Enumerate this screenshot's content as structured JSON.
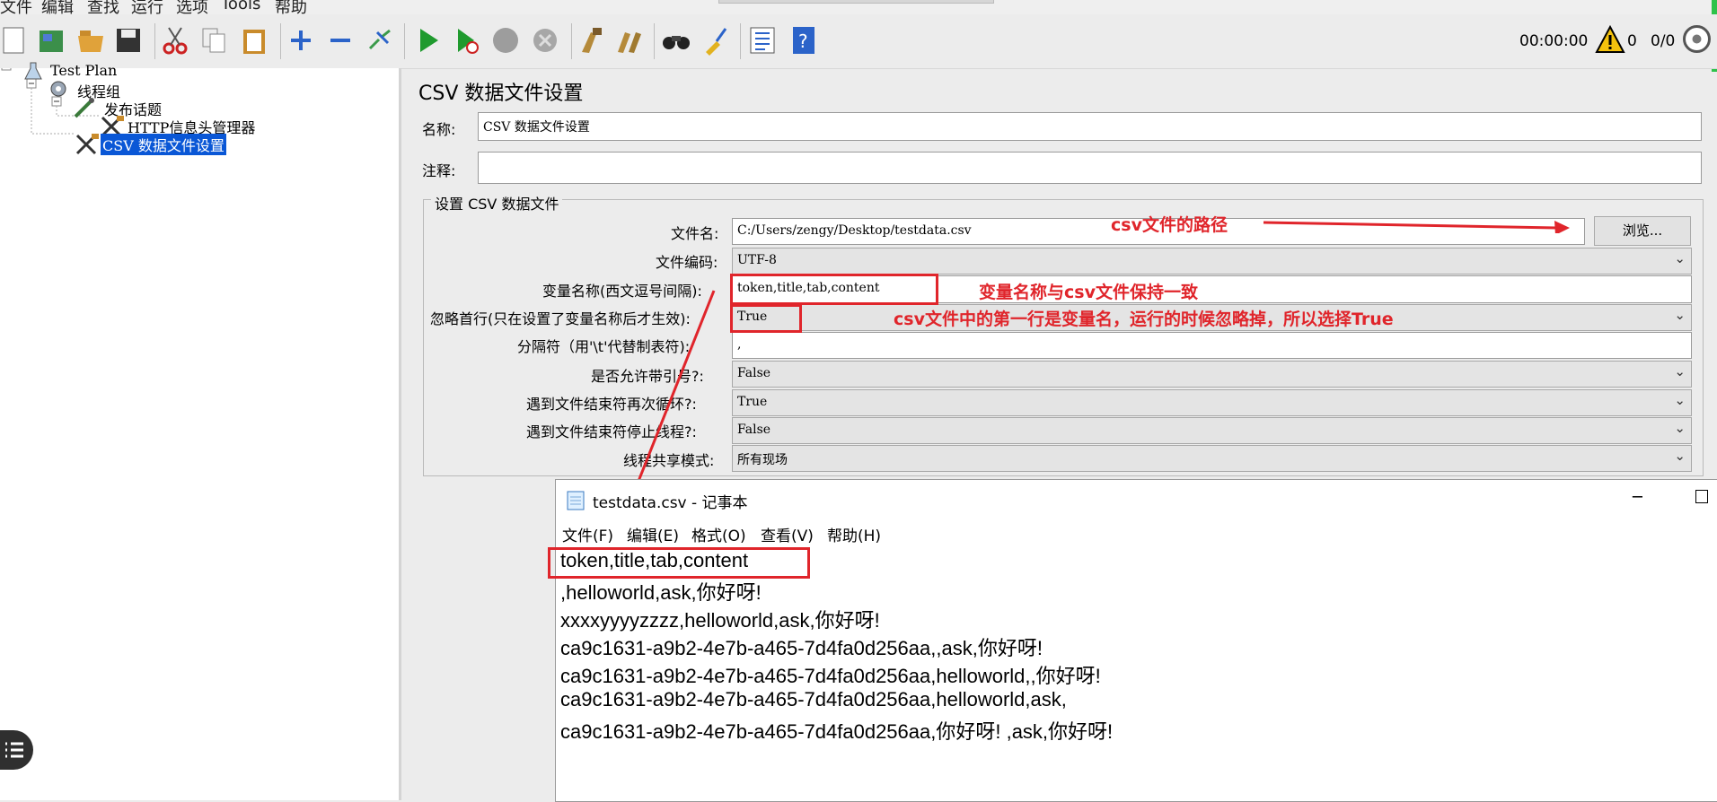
{
  "menubar": [
    "文件",
    "编辑",
    "查找",
    "运行",
    "选项",
    "Tools",
    "帮助"
  ],
  "toolbar": {
    "icons": [
      "new-icon",
      "templates-icon",
      "open-icon",
      "save-icon",
      "cut-icon",
      "copy-icon",
      "paste-icon",
      "expand-icon",
      "collapse-icon",
      "toggle-icon",
      "start-icon",
      "start-no-timers-icon",
      "stop-icon",
      "shutdown-icon",
      "clear-icon",
      "clear-all-icon",
      "search-icon",
      "reset-search-icon",
      "function-helper-icon",
      "help-icon"
    ],
    "timer": "00:00:00",
    "warnings": "0",
    "threads": "0/0"
  },
  "tree": {
    "items": [
      "Test Plan",
      "线程组",
      "发布话题",
      "HTTP信息头管理器",
      "CSV 数据文件设置"
    ]
  },
  "panel": {
    "title": "CSV 数据文件设置",
    "name_label": "名称:",
    "name_value": "CSV 数据文件设置",
    "comment_label": "注释:",
    "comment_value": "",
    "fieldset_legend": "设置 CSV 数据文件",
    "filename_label": "文件名:",
    "filename_value": "C:/Users/zengy/Desktop/testdata.csv",
    "browse_label": "浏览...",
    "encoding_label": "文件编码:",
    "encoding_value": "UTF-8",
    "varnames_label": "变量名称(西文逗号间隔):",
    "varnames_value": "token,title,tab,content",
    "ignore_label": "忽略首行(只在设置了变量名称后才生效):",
    "ignore_value": "True",
    "delimiter_label": "分隔符（用'\\t'代替制表符):",
    "delimiter_value": ",",
    "quoted_label": "是否允许带引号?:",
    "quoted_value": "False",
    "recycle_label": "遇到文件结束符再次循环?:",
    "recycle_value": "True",
    "stop_label": "遇到文件结束符停止线程?:",
    "stop_value": "False",
    "share_label": "线程共享模式:",
    "share_value": "所有现场"
  },
  "annotations": {
    "path_note": "csv文件的路径",
    "varname_note": "变量名称与csv文件保持一致",
    "ignore_note": "csv文件中的第一行是变量名，运行的时候忽略掉，所以选择True",
    "color": "#e0252b"
  },
  "notepad": {
    "title": "testdata.csv - 记事本",
    "menu": [
      "文件(F)",
      "编辑(E)",
      "格式(O)",
      "查看(V)",
      "帮助(H)"
    ],
    "lines": [
      "token,title,tab,content",
      ",helloworld,ask,你好呀!",
      "xxxxyyyyzzzz,helloworld,ask,你好呀!",
      "ca9c1631-a9b2-4e7b-a465-7d4fa0d256aa,,ask,你好呀!",
      "ca9c1631-a9b2-4e7b-a465-7d4fa0d256aa,helloworld,,你好呀!",
      "ca9c1631-a9b2-4e7b-a465-7d4fa0d256aa,helloworld,ask,",
      "ca9c1631-a9b2-4e7b-a465-7d4fa0d256aa,你好呀! ,ask,你好呀!"
    ]
  }
}
